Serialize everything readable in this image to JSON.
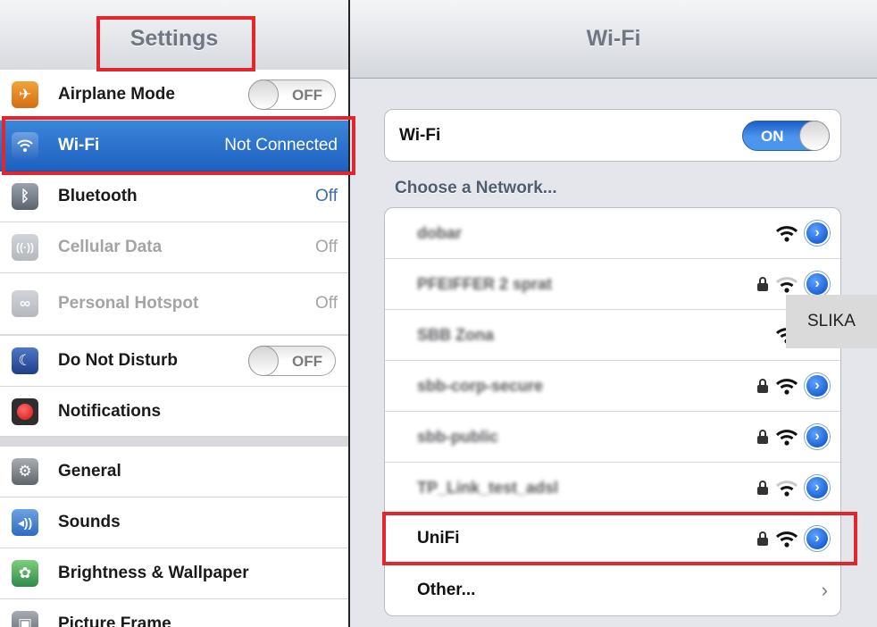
{
  "left": {
    "title": "Settings",
    "items": [
      {
        "label": "Airplane Mode",
        "toggle": "OFF",
        "icon": "airplane-icon"
      },
      {
        "label": "Wi-Fi",
        "value": "Not Connected",
        "icon": "wifi-icon",
        "selected": true
      },
      {
        "label": "Bluetooth",
        "value": "Off",
        "icon": "bluetooth-icon"
      },
      {
        "label": "Cellular Data",
        "value": "Off",
        "icon": "cellular-icon",
        "disabled": true
      },
      {
        "label": "Personal Hotspot",
        "value": "Off",
        "icon": "hotspot-icon",
        "disabled": true
      },
      {
        "label": "Do Not Disturb",
        "toggle": "OFF",
        "icon": "moon-icon"
      },
      {
        "label": "Notifications",
        "icon": "notifications-icon"
      },
      {
        "label": "General",
        "icon": "gear-icon"
      },
      {
        "label": "Sounds",
        "icon": "speaker-icon"
      },
      {
        "label": "Brightness & Wallpaper",
        "icon": "flower-icon"
      },
      {
        "label": "Picture Frame",
        "icon": "picture-frame-icon"
      }
    ]
  },
  "right": {
    "title": "Wi-Fi",
    "wifi_label": "Wi-Fi",
    "wifi_toggle": "ON",
    "choose_label": "Choose a Network...",
    "networks": [
      {
        "name": "dobar",
        "locked": false
      },
      {
        "name": "PFEIFFER 2 sprat",
        "locked": true
      },
      {
        "name": "SBB Zona",
        "locked": false
      },
      {
        "name": "sbb-corp-secure",
        "locked": true
      },
      {
        "name": "sbb-public",
        "locked": true
      },
      {
        "name": "TP_Link_test_adsl",
        "locked": true
      },
      {
        "name": "UniFi",
        "locked": true
      }
    ],
    "other_label": "Other...",
    "other_chevron": "›"
  },
  "overlay_label": "SLIKA",
  "colors": {
    "highlight": "#e3262b",
    "selection_blue": "#1f60c1",
    "value_blue": "#3d6ea5"
  }
}
